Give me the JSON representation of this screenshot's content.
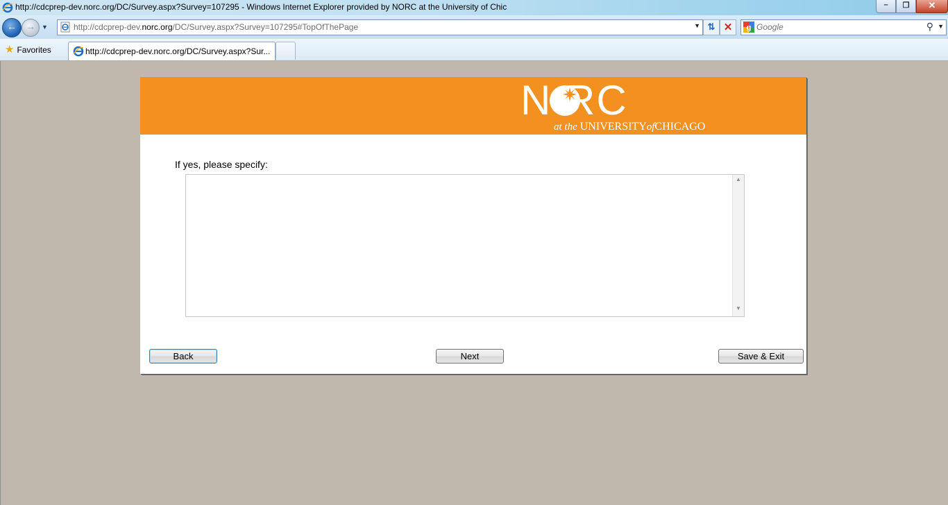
{
  "window": {
    "title": "http://cdcprep-dev.norc.org/DC/Survey.aspx?Survey=107295 - Windows Internet Explorer provided by NORC at the University of Chic",
    "minimize_glyph": "–",
    "maximize_glyph": "❐",
    "close_glyph": "✕"
  },
  "browser": {
    "address": {
      "prefix": "http://cdcprep-dev.",
      "domain": "norc.org",
      "suffix": "/DC/Survey.aspx?Survey=107295#TopOfThePage"
    },
    "search": {
      "placeholder": "Google"
    },
    "favorites_label": "Favorites",
    "tab_title": "http://cdcprep-dev.norc.org/DC/Survey.aspx?Sur..."
  },
  "page": {
    "logo": {
      "wordmark": "N  RC",
      "tagline_at_the": "at the",
      "tagline_university": "UNIVERSITY",
      "tagline_of": "of",
      "tagline_chicago": "CHICAGO"
    },
    "question_label": "If yes, please specify:",
    "answer_value": "",
    "buttons": {
      "back": "Back",
      "next": "Next",
      "save_exit": "Save & Exit"
    }
  },
  "colors": {
    "banner": "#f29120",
    "background": "#c0b8ad"
  }
}
